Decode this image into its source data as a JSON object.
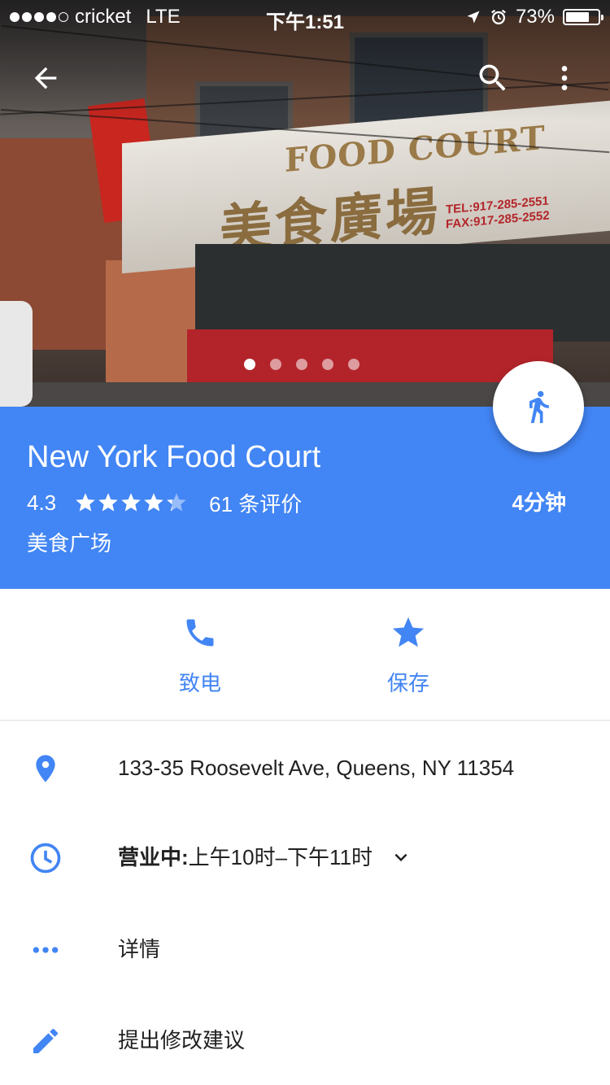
{
  "status_bar": {
    "carrier": "cricket",
    "network": "LTE",
    "time": "下午1:51",
    "battery_percent": "73%",
    "battery_level": 0.73
  },
  "toolbar": {
    "back_icon": "arrow-back-icon",
    "search_icon": "search-icon",
    "more_icon": "more-vert-icon"
  },
  "hero": {
    "sign_en": "FOOD COURT",
    "sign_cn": "美食廣場",
    "sign_tel": "TEL:917-285-2551",
    "sign_fax": "FAX:917-285-2552",
    "photo_count": 5,
    "active_photo": 1
  },
  "place": {
    "name": "New York Food Court",
    "rating": "4.3",
    "rating_value": 4.3,
    "reviews": "61 条评价",
    "category": "美食广场",
    "travel_time": "4分钟",
    "travel_mode_icon": "walk-icon"
  },
  "actions": {
    "call_label": "致电",
    "save_label": "保存"
  },
  "info": {
    "address": "133-35 Roosevelt Ave, Queens, NY 11354",
    "hours_status": "营业中:",
    "hours_range": " 上午10时–下午11时",
    "details": "详情",
    "suggest_edit": "提出修改建议"
  },
  "colors": {
    "accent": "#4285f4",
    "header_text": "#ffffff",
    "body_text": "#212121"
  }
}
